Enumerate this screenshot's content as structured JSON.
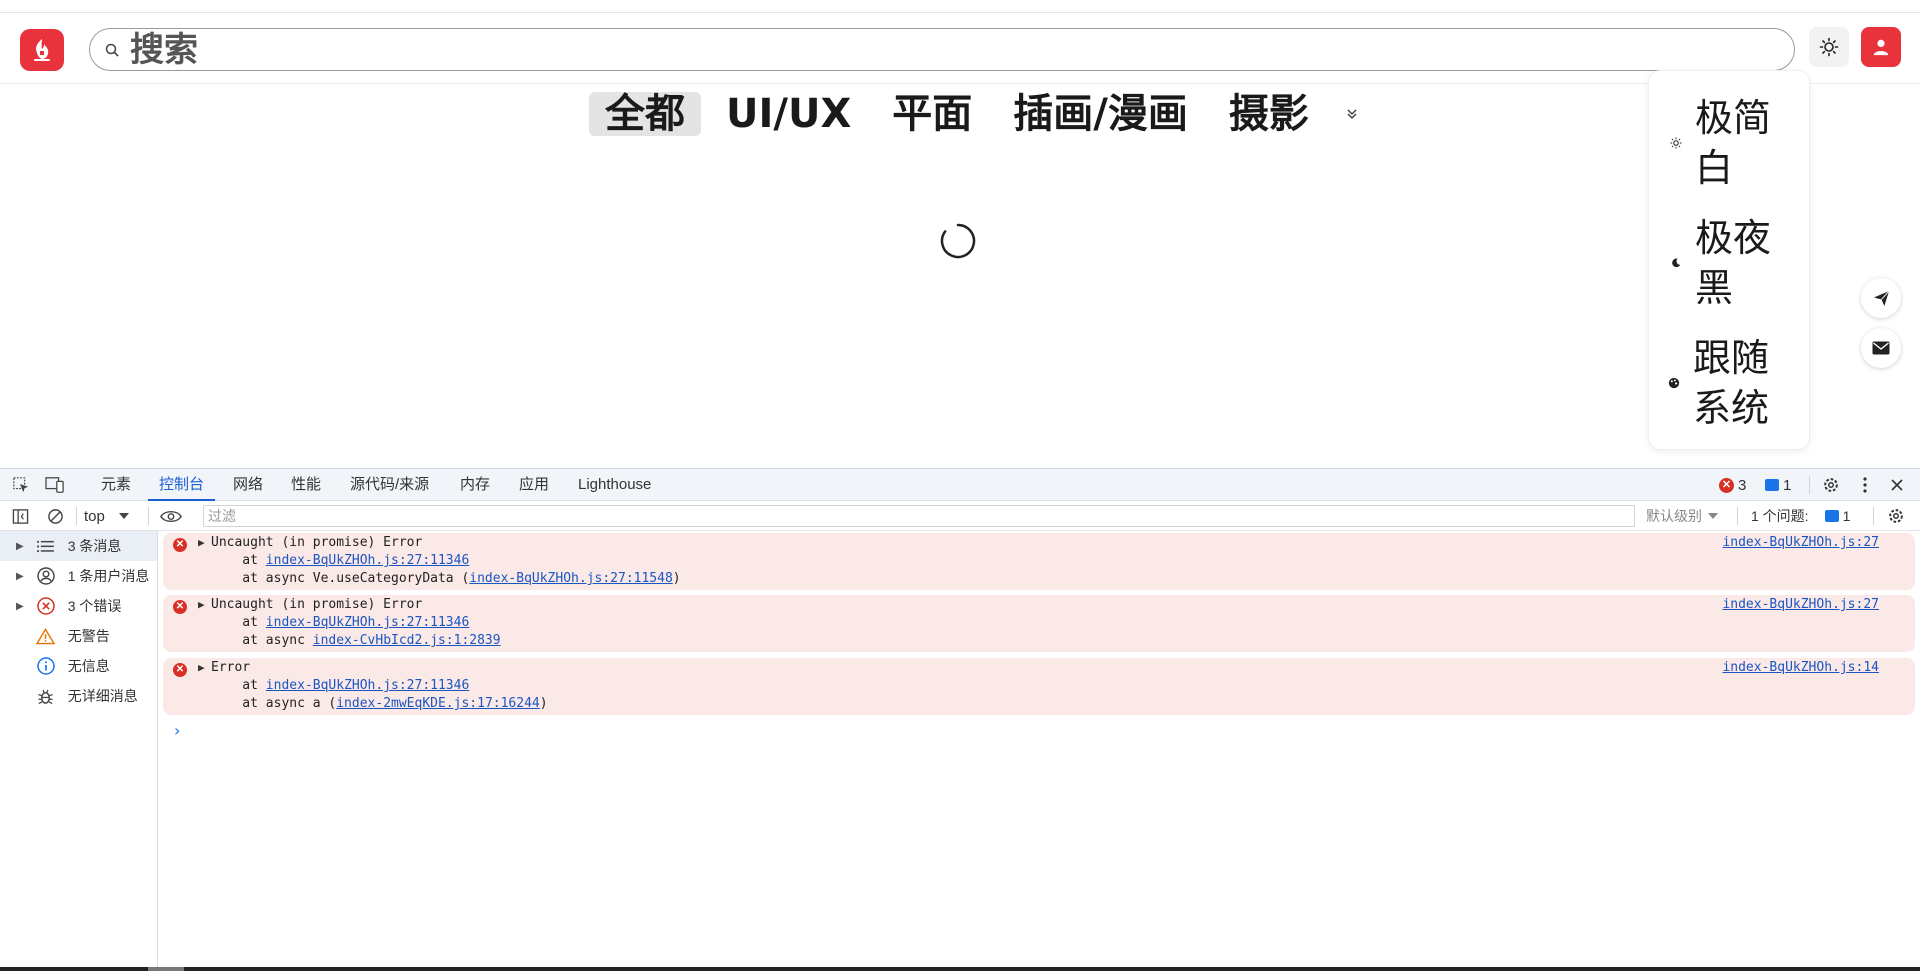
{
  "site": {
    "search": {
      "placeholder": "搜索",
      "value": ""
    },
    "categories": [
      {
        "label": "全都",
        "active": true
      },
      {
        "label": "UI/UX",
        "active": false
      },
      {
        "label": "平面",
        "active": false
      },
      {
        "label": "插画/漫画",
        "active": false
      },
      {
        "label": "摄影",
        "active": false
      }
    ],
    "theme_menu": [
      {
        "label": "极简白",
        "icon": "sun-icon"
      },
      {
        "label": "极夜黑",
        "icon": "moon-icon"
      },
      {
        "label": "跟随系统",
        "icon": "palette-icon"
      }
    ],
    "brand_color": "#e8323c"
  },
  "devtools": {
    "tabs": [
      {
        "label": "元素",
        "active": false
      },
      {
        "label": "控制台",
        "active": true
      },
      {
        "label": "网络",
        "active": false
      },
      {
        "label": "性能",
        "active": false
      },
      {
        "label": "源代码/来源",
        "active": false
      },
      {
        "label": "内存",
        "active": false
      },
      {
        "label": "应用",
        "active": false
      },
      {
        "label": "Lighthouse",
        "active": false
      }
    ],
    "error_count": "3",
    "message_count": "1",
    "context": "top",
    "filter_placeholder": "过滤",
    "level": "默认级别",
    "issues_label": "1 个问题:",
    "issues_count": "1",
    "sidebar": [
      {
        "label": "3 条消息",
        "icon": "list-icon",
        "expandable": true,
        "selected": true
      },
      {
        "label": "1 条用户消息",
        "icon": "user-icon",
        "expandable": true,
        "selected": false
      },
      {
        "label": "3 个错误",
        "icon": "error-icon",
        "expandable": true,
        "selected": false
      },
      {
        "label": "无警告",
        "icon": "warning-icon",
        "expandable": false,
        "selected": false
      },
      {
        "label": "无信息",
        "icon": "info-icon",
        "expandable": false,
        "selected": false
      },
      {
        "label": "无详细消息",
        "icon": "bug-icon",
        "expandable": false,
        "selected": false
      }
    ],
    "messages": [
      {
        "title": "Uncaught (in promise) Error",
        "source": "index-BqUkZHOh.js:27",
        "line2_prefix": "    at ",
        "line2_link": "index-BqUkZHOh.js:27:11346",
        "line3_prefix": "    at async Ve.useCategoryData (",
        "line3_link": "index-BqUkZHOh.js:27:11548",
        "line3_suffix": ")"
      },
      {
        "title": "Uncaught (in promise) Error",
        "source": "index-BqUkZHOh.js:27",
        "line2_prefix": "    at ",
        "line2_link": "index-BqUkZHOh.js:27:11346",
        "line3_prefix": "    at async ",
        "line3_link": "index-CvHbIcd2.js:1:2839",
        "line3_suffix": ""
      },
      {
        "title": "Error",
        "source": "index-BqUkZHOh.js:14",
        "line2_prefix": "    at ",
        "line2_link": "index-BqUkZHOh.js:27:11346",
        "line3_prefix": "    at async a (",
        "line3_link": "index-2mwEqKDE.js:17:16244",
        "line3_suffix": ")"
      }
    ]
  }
}
